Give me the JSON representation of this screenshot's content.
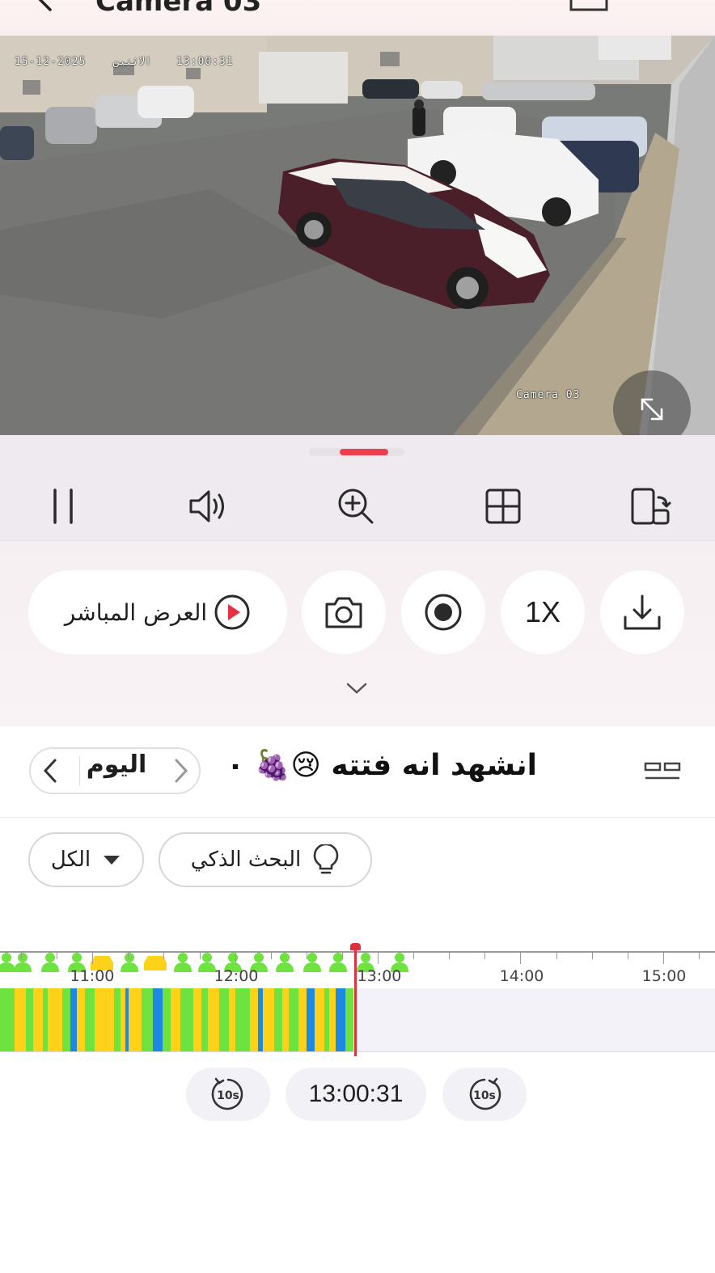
{
  "header": {
    "title": "Camera 03"
  },
  "video": {
    "osd_datetime": "15-12-2025",
    "osd_weekday": "الاثنين",
    "osd_time": "13:00:31",
    "osd_camera_name": "Camera 03"
  },
  "controls": {
    "toolbar": [
      "pause-icon",
      "volume-icon",
      "zoom-in-icon",
      "grid-view-icon",
      "rotate-screen-icon"
    ],
    "live_label": "العرض المباشر",
    "speed_label": "1X"
  },
  "day_selector": {
    "label": "اليوم"
  },
  "caption": "انشهد انه فتته 😢🍇 ۰",
  "filters": {
    "smart_search_label": "البحث الذكي",
    "type_label": "الكل"
  },
  "timeline": {
    "tick_labels": [
      "11:00",
      "12:00",
      "13:00",
      "14:00",
      "15:00"
    ],
    "current_time": "13:00:31",
    "colors": {
      "person": "#6ee23f",
      "vehicle": "#ffd21a",
      "motion": "#1e88e5",
      "cursor": "#e0303e"
    }
  }
}
